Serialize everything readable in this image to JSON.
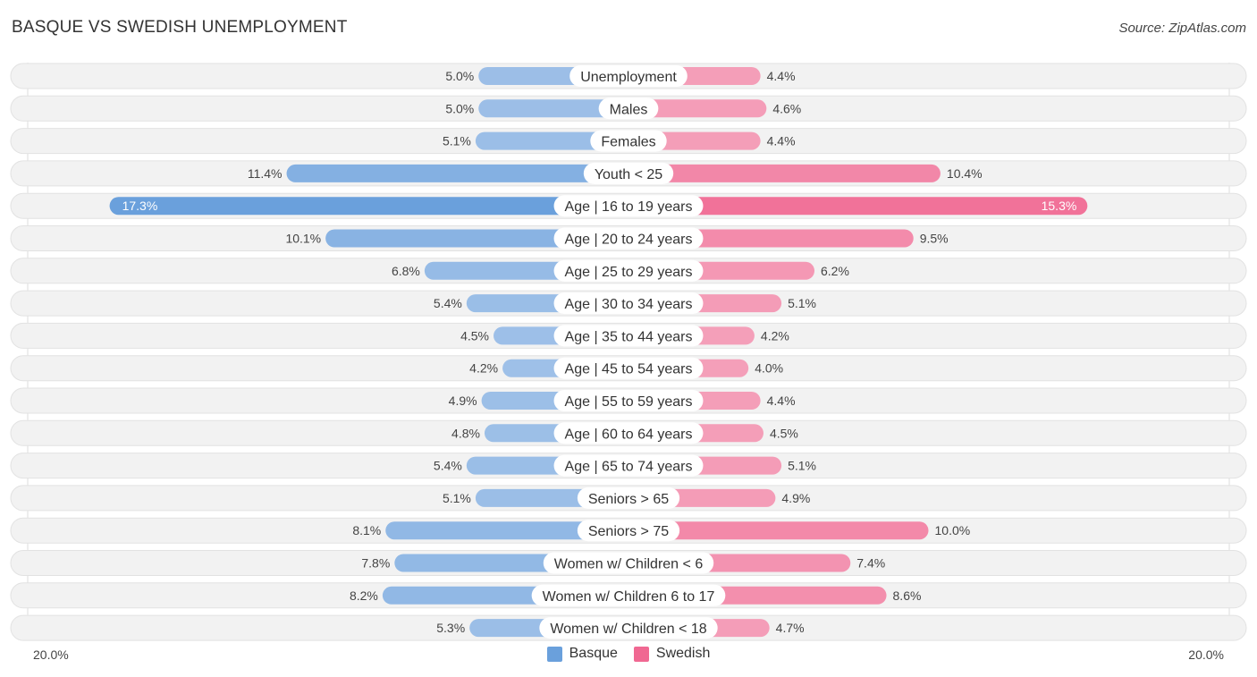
{
  "header": {
    "title": "BASQUE VS SWEDISH UNEMPLOYMENT",
    "source": "Source: ZipAtlas.com"
  },
  "legend": {
    "basque_label": "Basque",
    "swedish_label": "Swedish"
  },
  "axis": {
    "left_label": "20.0%",
    "right_label": "20.0%"
  },
  "colors": {
    "basque": "#6aa0dc",
    "basque_light": "#a8c6ea",
    "swedish": "#f06892",
    "swedish_light": "#f5a9c0",
    "row_bg": "#f2f2f2"
  },
  "chart_data": {
    "type": "bar",
    "orientation": "horizontal-diverging",
    "title": "BASQUE VS SWEDISH UNEMPLOYMENT",
    "xlim": [
      -20,
      20
    ],
    "unit": "%",
    "categories": [
      "Unemployment",
      "Males",
      "Females",
      "Youth < 25",
      "Age | 16 to 19 years",
      "Age | 20 to 24 years",
      "Age | 25 to 29 years",
      "Age | 30 to 34 years",
      "Age | 35 to 44 years",
      "Age | 45 to 54 years",
      "Age | 55 to 59 years",
      "Age | 60 to 64 years",
      "Age | 65 to 74 years",
      "Seniors > 65",
      "Seniors > 75",
      "Women w/ Children < 6",
      "Women w/ Children 6 to 17",
      "Women w/ Children < 18"
    ],
    "series": [
      {
        "name": "Basque",
        "side": "left",
        "values": [
          5.0,
          5.0,
          5.1,
          11.4,
          17.3,
          10.1,
          6.8,
          5.4,
          4.5,
          4.2,
          4.9,
          4.8,
          5.4,
          5.1,
          8.1,
          7.8,
          8.2,
          5.3
        ]
      },
      {
        "name": "Swedish",
        "side": "right",
        "values": [
          4.4,
          4.6,
          4.4,
          10.4,
          15.3,
          9.5,
          6.2,
          5.1,
          4.2,
          4.0,
          4.4,
          4.5,
          5.1,
          4.9,
          10.0,
          7.4,
          8.6,
          4.7
        ]
      }
    ],
    "legend_position": "bottom-center",
    "axis_labels": [
      "20.0%",
      "20.0%"
    ]
  }
}
